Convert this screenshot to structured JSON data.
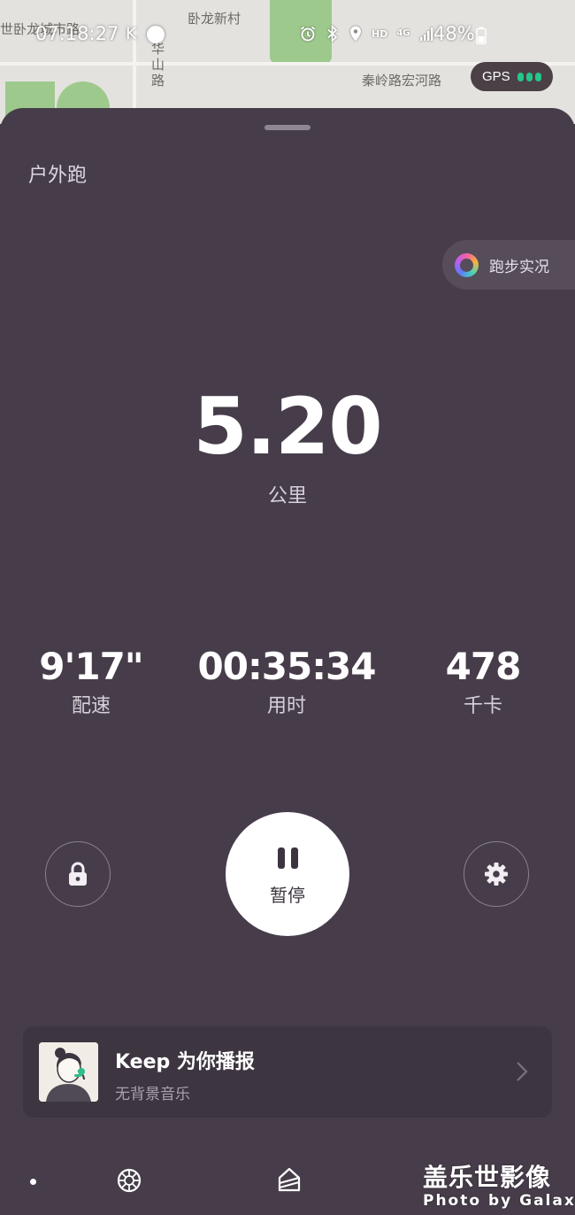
{
  "map": {
    "labels": [
      "世卧龙城市路",
      "卧龙新村",
      "华山路",
      "秦岭路宏河路"
    ]
  },
  "status_bar": {
    "time": "07:18:27",
    "carrier_icon": "K",
    "hd": "HD",
    "network": "4G",
    "battery": "48%",
    "icons": [
      "alarm-icon",
      "bluetooth-icon",
      "location-icon",
      "signal-icon",
      "battery-icon"
    ]
  },
  "gps": {
    "label": "GPS",
    "strength_bars": 3,
    "color": "#24c789"
  },
  "header": {
    "mode": "户外跑"
  },
  "live_button": {
    "label": "跑步实况"
  },
  "distance": {
    "value": "5.20",
    "unit": "公里"
  },
  "stats": [
    {
      "value": "9'17\"",
      "label": "配速"
    },
    {
      "value": "00:35:34",
      "label": "用时"
    },
    {
      "value": "478",
      "label": "千卡"
    }
  ],
  "controls": {
    "pause_label": "暂停"
  },
  "voice_card": {
    "title": "Keep 为你播报",
    "subtitle": "无背景音乐"
  },
  "watermark": {
    "cn": "盖乐世影像",
    "en": "Photo by Galaxy"
  },
  "colors": {
    "panel": "#473d4a",
    "accent_green": "#24c789"
  }
}
